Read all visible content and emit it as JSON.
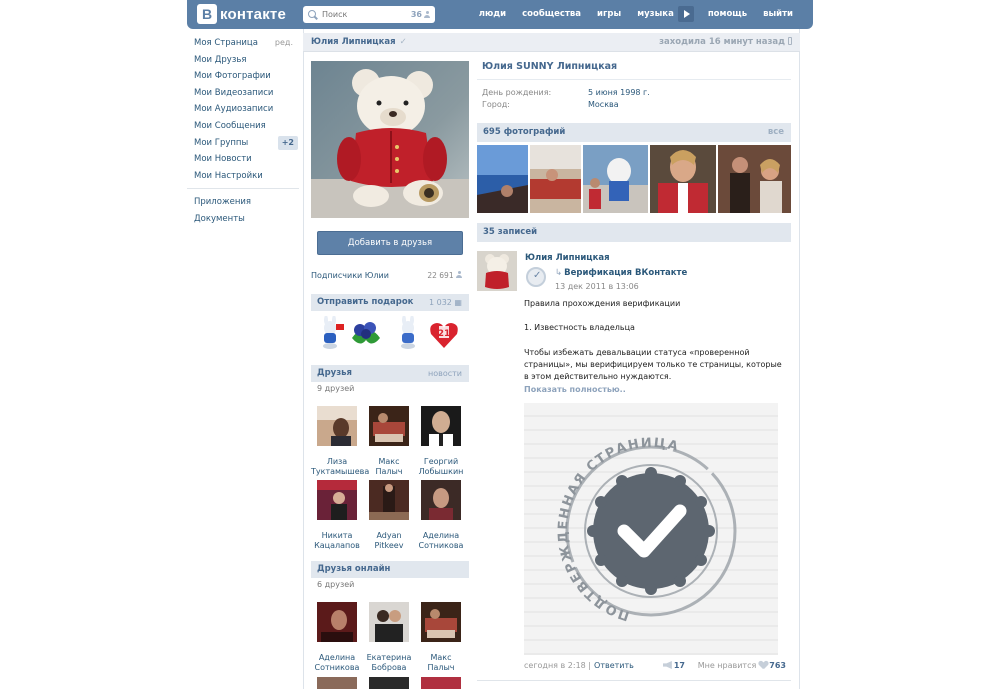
{
  "header": {
    "logo_letter": "B",
    "logo_text": "контакте",
    "search_placeholder": "Поиск",
    "search_count": "36",
    "nav": [
      "люди",
      "сообщества",
      "игры",
      "музыка",
      "помощь",
      "выйти"
    ]
  },
  "leftmenu": {
    "items": [
      "Моя Страница",
      "Мои Друзья",
      "Мои Фотографии",
      "Мои Видеозаписи",
      "Мои Аудиозаписи",
      "Мои Сообщения",
      "Мои Группы",
      "Мои Новости",
      "Мои Настройки"
    ],
    "edit_label": "ред.",
    "groups_badge": "+2",
    "extra": [
      "Приложения",
      "Документы"
    ]
  },
  "namebar": {
    "name": "Юлия Липницкая",
    "check": "✓",
    "status": "заходила 16 минут назад"
  },
  "profile": {
    "add_friend": "Добавить в друзья",
    "subscribers_label": "Подписчики Юлии",
    "subscribers_count": "22 691",
    "gift_title": "Отправить подарок",
    "gift_count": "1 032",
    "friends_title": "Друзья",
    "friends_news": "новости",
    "friends_count": "9 друзей",
    "friends": [
      {
        "first": "Лиза",
        "last": "Туктамышева"
      },
      {
        "first": "Макс",
        "last": "Палыч"
      },
      {
        "first": "Георгий",
        "last": "Лобышкин"
      },
      {
        "first": "Никита",
        "last": "Кацалапов"
      },
      {
        "first": "Adyan",
        "last": "Pitkeev"
      },
      {
        "first": "Аделина",
        "last": "Сотникова"
      }
    ],
    "online_title": "Друзья онлайн",
    "online_count": "6 друзей",
    "online": [
      {
        "first": "Аделина",
        "last": "Сотникова"
      },
      {
        "first": "Екатерина",
        "last": "Боброва"
      },
      {
        "first": "Макс",
        "last": "Палыч"
      }
    ]
  },
  "info": {
    "full_name": "Юлия SUNNY Липницкая",
    "birthday_label": "День рождения:",
    "birthday_value": "5 июня 1998 г.",
    "city_label": "Город:",
    "city_value": "Москва"
  },
  "photos": {
    "title": "695 фотографий",
    "all": "все"
  },
  "wall": {
    "title": "35 записей",
    "author": "Юлия Липницкая",
    "repost_arrow": "↳",
    "repost_name": "Верификация ВКонтакте",
    "repost_date": "13 дек 2011 в 13:06",
    "text1": "Правила прохождения верификации",
    "text2": "1. Известность владельца",
    "text3": "Чтобы избежать девальвации статуса «проверенной страницы», мы верифицируем только те страницы, которые в этом действительно нуждаются.",
    "show_more": "Показать полностью..",
    "stamp_text": "ПОДТВЕРЖДЕННАЯ СТРАНИЦА",
    "foot_time": "сегодня в 2:18",
    "foot_reply": "Ответить",
    "shares": "17",
    "like_label": "Мне нравится",
    "likes": "763"
  }
}
